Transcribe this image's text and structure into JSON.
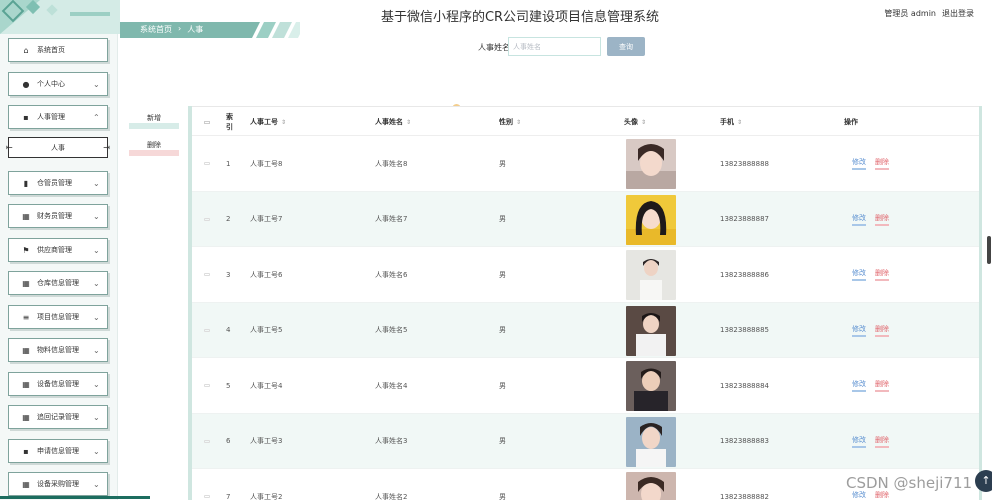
{
  "header": {
    "system_title": "基于微信小程序的CR公司建设项目信息管理系统",
    "user_label": "管理员 admin",
    "logout_label": "退出登录",
    "breadcrumb": [
      "系统首页",
      "人事"
    ]
  },
  "search": {
    "label": "人事姓名",
    "placeholder": "人事姓名",
    "button_label": "查询"
  },
  "sidebar": {
    "items": [
      {
        "label": "系统首页",
        "icon": "home-icon",
        "has_chevron": false
      },
      {
        "label": "个人中心",
        "icon": "user-icon",
        "has_chevron": true
      },
      {
        "label": "人事管理",
        "icon": "briefcase-icon",
        "has_chevron": true,
        "expanded": true
      },
      {
        "label": "仓管员管理",
        "icon": "bar-chart-icon",
        "has_chevron": true
      },
      {
        "label": "财务员管理",
        "icon": "grid-icon",
        "has_chevron": true
      },
      {
        "label": "供应商管理",
        "icon": "flag-icon",
        "has_chevron": true
      },
      {
        "label": "仓库信息管理",
        "icon": "grid-icon",
        "has_chevron": true
      },
      {
        "label": "项目信息管理",
        "icon": "list-icon",
        "has_chevron": true
      },
      {
        "label": "物料信息管理",
        "icon": "grid-icon",
        "has_chevron": true
      },
      {
        "label": "设备信息管理",
        "icon": "grid-icon",
        "has_chevron": true
      },
      {
        "label": "追回记录管理",
        "icon": "grid-icon",
        "has_chevron": true
      },
      {
        "label": "申请信息管理",
        "icon": "briefcase-icon",
        "has_chevron": true
      },
      {
        "label": "设备采购管理",
        "icon": "grid-icon",
        "has_chevron": true
      }
    ],
    "submenu_label": "人事"
  },
  "actions": {
    "add_label": "新增",
    "delete_label": "删除"
  },
  "table": {
    "headers": {
      "index_top": "索",
      "index_bottom": "引",
      "staff_no": "人事工号",
      "staff_name": "人事姓名",
      "gender": "性别",
      "avatar": "头像",
      "phone": "手机",
      "ops": "操作"
    },
    "edit_label": "修改",
    "delete_label": "删除",
    "rows": [
      {
        "index": "1",
        "staff_no": "人事工号8",
        "staff_name": "人事姓名8",
        "gender": "男",
        "phone": "13823888888"
      },
      {
        "index": "2",
        "staff_no": "人事工号7",
        "staff_name": "人事姓名7",
        "gender": "男",
        "phone": "13823888887"
      },
      {
        "index": "3",
        "staff_no": "人事工号6",
        "staff_name": "人事姓名6",
        "gender": "男",
        "phone": "13823888886"
      },
      {
        "index": "4",
        "staff_no": "人事工号5",
        "staff_name": "人事姓名5",
        "gender": "男",
        "phone": "13823888885"
      },
      {
        "index": "5",
        "staff_no": "人事工号4",
        "staff_name": "人事姓名4",
        "gender": "男",
        "phone": "13823888884"
      },
      {
        "index": "6",
        "staff_no": "人事工号3",
        "staff_name": "人事姓名3",
        "gender": "男",
        "phone": "13823888883"
      },
      {
        "index": "7",
        "staff_no": "人事工号2",
        "staff_name": "人事姓名2",
        "gender": "男",
        "phone": "13823888882"
      }
    ]
  },
  "watermark": "CSDN @sheji711",
  "colors": {
    "accent": "#1c6d5f",
    "sidebar_bg": "#f4f8f7",
    "row_alt": "#f1f8f6",
    "edit": "#5a8fd0",
    "delete": "#e0636a",
    "search_button": "#9cb4c6"
  }
}
